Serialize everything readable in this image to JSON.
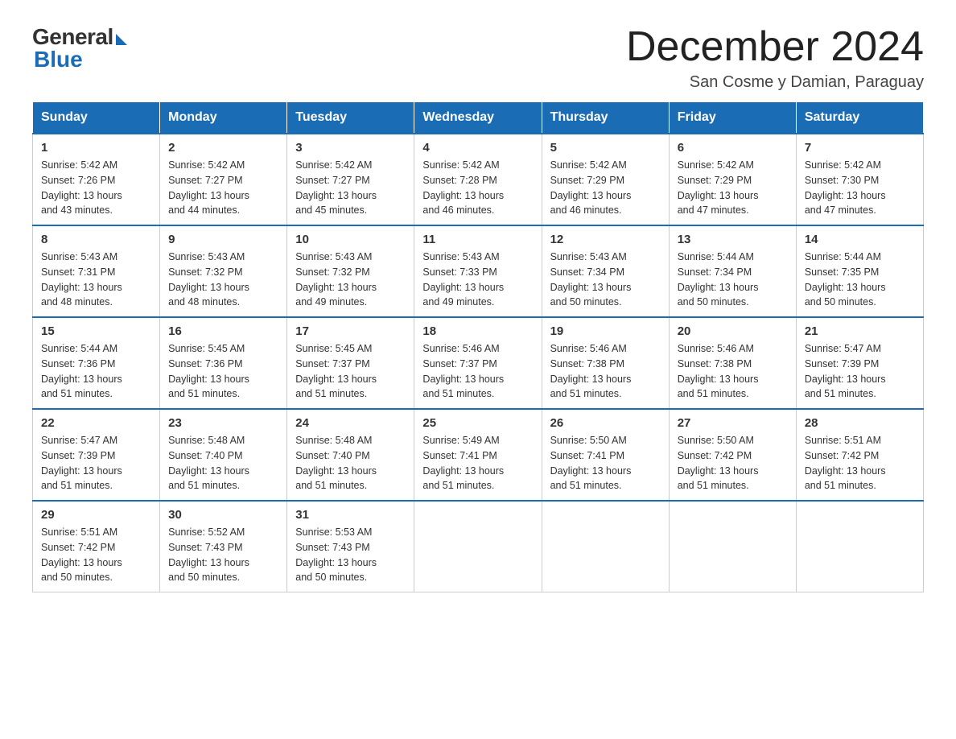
{
  "logo": {
    "general": "General",
    "blue": "Blue"
  },
  "title": "December 2024",
  "subtitle": "San Cosme y Damian, Paraguay",
  "header_days": [
    "Sunday",
    "Monday",
    "Tuesday",
    "Wednesday",
    "Thursday",
    "Friday",
    "Saturday"
  ],
  "weeks": [
    [
      {
        "day": "1",
        "sunrise": "5:42 AM",
        "sunset": "7:26 PM",
        "daylight": "13 hours and 43 minutes."
      },
      {
        "day": "2",
        "sunrise": "5:42 AM",
        "sunset": "7:27 PM",
        "daylight": "13 hours and 44 minutes."
      },
      {
        "day": "3",
        "sunrise": "5:42 AM",
        "sunset": "7:27 PM",
        "daylight": "13 hours and 45 minutes."
      },
      {
        "day": "4",
        "sunrise": "5:42 AM",
        "sunset": "7:28 PM",
        "daylight": "13 hours and 46 minutes."
      },
      {
        "day": "5",
        "sunrise": "5:42 AM",
        "sunset": "7:29 PM",
        "daylight": "13 hours and 46 minutes."
      },
      {
        "day": "6",
        "sunrise": "5:42 AM",
        "sunset": "7:29 PM",
        "daylight": "13 hours and 47 minutes."
      },
      {
        "day": "7",
        "sunrise": "5:42 AM",
        "sunset": "7:30 PM",
        "daylight": "13 hours and 47 minutes."
      }
    ],
    [
      {
        "day": "8",
        "sunrise": "5:43 AM",
        "sunset": "7:31 PM",
        "daylight": "13 hours and 48 minutes."
      },
      {
        "day": "9",
        "sunrise": "5:43 AM",
        "sunset": "7:32 PM",
        "daylight": "13 hours and 48 minutes."
      },
      {
        "day": "10",
        "sunrise": "5:43 AM",
        "sunset": "7:32 PM",
        "daylight": "13 hours and 49 minutes."
      },
      {
        "day": "11",
        "sunrise": "5:43 AM",
        "sunset": "7:33 PM",
        "daylight": "13 hours and 49 minutes."
      },
      {
        "day": "12",
        "sunrise": "5:43 AM",
        "sunset": "7:34 PM",
        "daylight": "13 hours and 50 minutes."
      },
      {
        "day": "13",
        "sunrise": "5:44 AM",
        "sunset": "7:34 PM",
        "daylight": "13 hours and 50 minutes."
      },
      {
        "day": "14",
        "sunrise": "5:44 AM",
        "sunset": "7:35 PM",
        "daylight": "13 hours and 50 minutes."
      }
    ],
    [
      {
        "day": "15",
        "sunrise": "5:44 AM",
        "sunset": "7:36 PM",
        "daylight": "13 hours and 51 minutes."
      },
      {
        "day": "16",
        "sunrise": "5:45 AM",
        "sunset": "7:36 PM",
        "daylight": "13 hours and 51 minutes."
      },
      {
        "day": "17",
        "sunrise": "5:45 AM",
        "sunset": "7:37 PM",
        "daylight": "13 hours and 51 minutes."
      },
      {
        "day": "18",
        "sunrise": "5:46 AM",
        "sunset": "7:37 PM",
        "daylight": "13 hours and 51 minutes."
      },
      {
        "day": "19",
        "sunrise": "5:46 AM",
        "sunset": "7:38 PM",
        "daylight": "13 hours and 51 minutes."
      },
      {
        "day": "20",
        "sunrise": "5:46 AM",
        "sunset": "7:38 PM",
        "daylight": "13 hours and 51 minutes."
      },
      {
        "day": "21",
        "sunrise": "5:47 AM",
        "sunset": "7:39 PM",
        "daylight": "13 hours and 51 minutes."
      }
    ],
    [
      {
        "day": "22",
        "sunrise": "5:47 AM",
        "sunset": "7:39 PM",
        "daylight": "13 hours and 51 minutes."
      },
      {
        "day": "23",
        "sunrise": "5:48 AM",
        "sunset": "7:40 PM",
        "daylight": "13 hours and 51 minutes."
      },
      {
        "day": "24",
        "sunrise": "5:48 AM",
        "sunset": "7:40 PM",
        "daylight": "13 hours and 51 minutes."
      },
      {
        "day": "25",
        "sunrise": "5:49 AM",
        "sunset": "7:41 PM",
        "daylight": "13 hours and 51 minutes."
      },
      {
        "day": "26",
        "sunrise": "5:50 AM",
        "sunset": "7:41 PM",
        "daylight": "13 hours and 51 minutes."
      },
      {
        "day": "27",
        "sunrise": "5:50 AM",
        "sunset": "7:42 PM",
        "daylight": "13 hours and 51 minutes."
      },
      {
        "day": "28",
        "sunrise": "5:51 AM",
        "sunset": "7:42 PM",
        "daylight": "13 hours and 51 minutes."
      }
    ],
    [
      {
        "day": "29",
        "sunrise": "5:51 AM",
        "sunset": "7:42 PM",
        "daylight": "13 hours and 50 minutes."
      },
      {
        "day": "30",
        "sunrise": "5:52 AM",
        "sunset": "7:43 PM",
        "daylight": "13 hours and 50 minutes."
      },
      {
        "day": "31",
        "sunrise": "5:53 AM",
        "sunset": "7:43 PM",
        "daylight": "13 hours and 50 minutes."
      },
      null,
      null,
      null,
      null
    ]
  ],
  "labels": {
    "sunrise": "Sunrise:",
    "sunset": "Sunset:",
    "daylight": "Daylight:"
  }
}
